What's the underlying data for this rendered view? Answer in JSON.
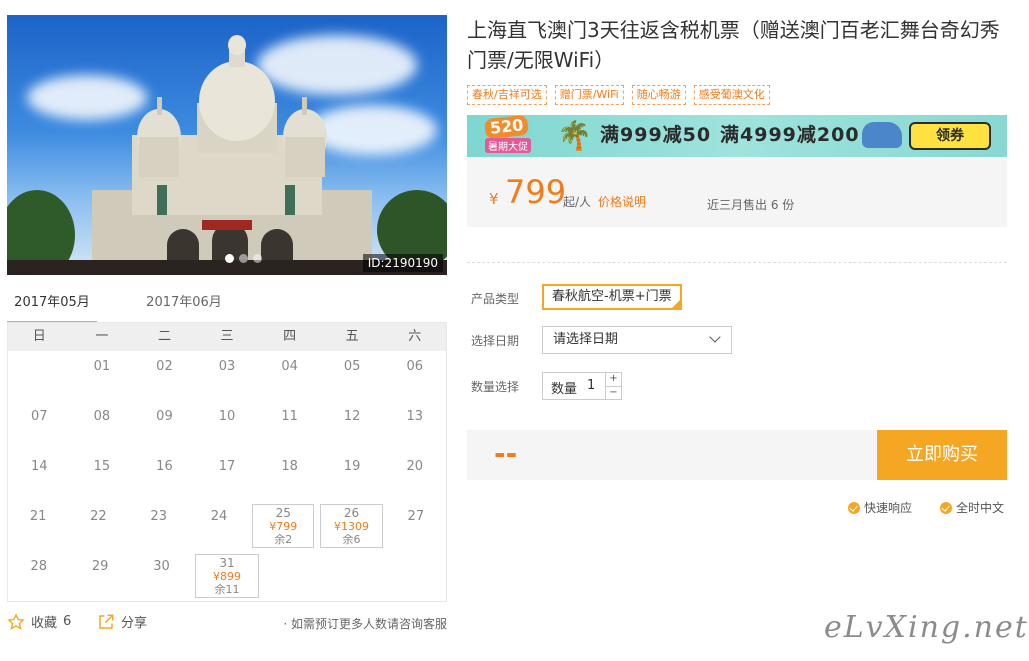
{
  "gallery": {
    "image_id": "ID:2190190",
    "photo_icon": "basilica-photo",
    "slide_count": 3,
    "active_slide": 1
  },
  "calendar": {
    "months": [
      "2017年05月",
      "2017年06月"
    ],
    "active_month": 0,
    "weekdays": [
      "日",
      "一",
      "二",
      "三",
      "四",
      "五",
      "六"
    ],
    "weeks": [
      [
        {
          "d": ""
        },
        {
          "d": "01"
        },
        {
          "d": "02"
        },
        {
          "d": "03"
        },
        {
          "d": "04"
        },
        {
          "d": "05"
        },
        {
          "d": "06"
        }
      ],
      [
        {
          "d": "07"
        },
        {
          "d": "08"
        },
        {
          "d": "09"
        },
        {
          "d": "10"
        },
        {
          "d": "11"
        },
        {
          "d": "12"
        },
        {
          "d": "13"
        }
      ],
      [
        {
          "d": "14"
        },
        {
          "d": "15"
        },
        {
          "d": "16"
        },
        {
          "d": "17"
        },
        {
          "d": "18"
        },
        {
          "d": "19"
        },
        {
          "d": "20"
        }
      ],
      [
        {
          "d": "21"
        },
        {
          "d": "22"
        },
        {
          "d": "23"
        },
        {
          "d": "24"
        },
        {
          "d": "25",
          "price": "¥799",
          "rem": "余2"
        },
        {
          "d": "26",
          "price": "¥1309",
          "rem": "余6"
        },
        {
          "d": "27"
        }
      ],
      [
        {
          "d": "28"
        },
        {
          "d": "29"
        },
        {
          "d": "30"
        },
        {
          "d": "31",
          "price": "¥899",
          "rem": "余11"
        },
        {
          "d": ""
        },
        {
          "d": ""
        },
        {
          "d": ""
        }
      ]
    ]
  },
  "actions": {
    "favorite_label": "收藏",
    "favorite_count": "6",
    "share_label": "分享",
    "note": "· 如需预订更多人数请咨询客服"
  },
  "product": {
    "title": "上海直飞澳门3天往返含税机票（赠送澳门百老汇舞台奇幻秀门票/无限WiFi）",
    "tags": [
      "春秋/吉祥可选",
      "赠门票/WiFi",
      "随心畅游",
      "感受葡澳文化"
    ]
  },
  "promo": {
    "badge": "520",
    "badge_sub": "暑期大促",
    "deal1": "满999减50",
    "deal2": "满4999减200",
    "coupon_label": "领券",
    "accent": "#f5a623"
  },
  "price": {
    "currency": "¥",
    "amount": "799",
    "unit": "起/人",
    "explain": "价格说明",
    "sold": "近三月售出 6 份"
  },
  "options": {
    "type_label": "产品类型",
    "type_value": "春秋航空-机票+门票",
    "date_label": "选择日期",
    "date_placeholder": "请选择日期",
    "qty_label": "数量选择",
    "qty_inner": "数量",
    "qty_value": "1",
    "plus": "+",
    "minus": "−"
  },
  "buy": {
    "total": "--",
    "button": "立即购买"
  },
  "services": [
    "快速响应",
    "全时中文"
  ],
  "watermark": "eLvXing.net"
}
